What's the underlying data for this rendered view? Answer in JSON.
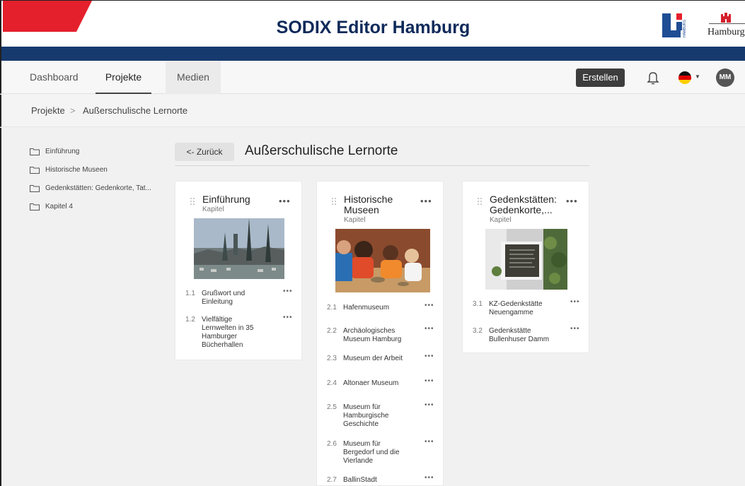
{
  "header": {
    "title": "SODIX Editor Hamburg",
    "hamburg_logo_text": "Hamburg",
    "li_logo_text": "HAMBURG"
  },
  "nav": {
    "tabs": [
      "Dashboard",
      "Projekte",
      "Medien"
    ],
    "create_label": "Erstellen",
    "avatar_initials": "MM"
  },
  "breadcrumb": {
    "root": "Projekte",
    "separator": ">",
    "current": "Außerschulische Lernorte"
  },
  "sidebar": {
    "items": [
      "Einführung",
      "Historische Museen",
      "Gedenkstätten: Gedenkorte, Tat...",
      "Kapitel 4"
    ]
  },
  "main": {
    "back_label": "<- Zurück",
    "title": "Außerschulische Lernorte",
    "chapters": [
      {
        "title_line1": "Einführung",
        "title_line2": "",
        "type": "Kapitel",
        "more": "•••",
        "items": [
          {
            "num": "1.1",
            "label": "Grußwort und Einleitung",
            "more": "•••"
          },
          {
            "num": "1.2",
            "label": "Vielfältige Lernwelten in 35 Hamburger Bücherhallen",
            "more": "•••"
          }
        ]
      },
      {
        "title_line1": "Historische",
        "title_line2": "Museen",
        "type": "Kapitel",
        "more": "•••",
        "items": [
          {
            "num": "2.1",
            "label": "Hafenmuseum",
            "more": "•••"
          },
          {
            "num": "2.2",
            "label": "Archäologisches Museum Hamburg",
            "more": "•••"
          },
          {
            "num": "2.3",
            "label": "Museum der Arbeit",
            "more": "•••"
          },
          {
            "num": "2.4",
            "label": "Altonaer Museum",
            "more": "•••"
          },
          {
            "num": "2.5",
            "label": "Museum für Hamburgische Geschichte",
            "more": "•••"
          },
          {
            "num": "2.6",
            "label": "Museum für Bergedorf und die Vierlande",
            "more": "•••"
          },
          {
            "num": "2.7",
            "label": "BallinStadt",
            "more": "•••"
          }
        ]
      },
      {
        "title_line1": "Gedenkstätten:",
        "title_line2": "Gedenkorte,...",
        "type": "Kapitel",
        "more": "•••",
        "items": [
          {
            "num": "3.1",
            "label": "KZ-Gedenkstätte Neuengamme",
            "more": "•••"
          },
          {
            "num": "3.2",
            "label": "Gedenkstätte Bullenhuser Damm",
            "more": "•••"
          }
        ]
      }
    ]
  },
  "colors": {
    "navy": "#0f2a5a",
    "blue_bar": "#173a6e",
    "red": "#e4202c",
    "dark_button": "#3d3d3d"
  }
}
